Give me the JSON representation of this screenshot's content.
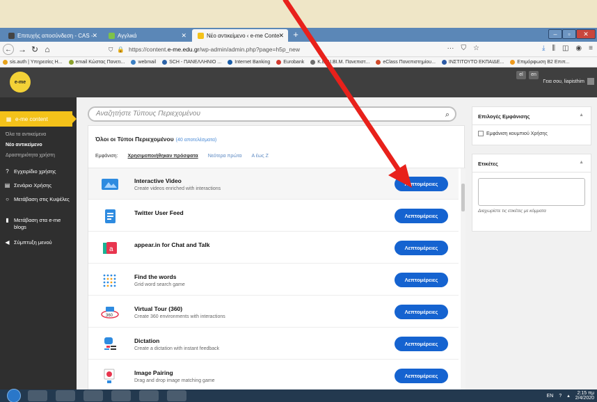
{
  "browser": {
    "tabs": [
      {
        "label": "Επιτυχής αποσύνδεση - CAS -",
        "icon": "cas-tab-icon"
      },
      {
        "label": "Αγγλικά",
        "icon": "translate-tab-icon"
      },
      {
        "label": "Νέο αντικείμενο ‹ e-me Conte",
        "icon": "eme-tab-icon"
      }
    ],
    "url_prefix": "https://content.",
    "url_domain": "e-me.edu.gr",
    "url_suffix": "/wp-admin/admin.php?page=h5p_new",
    "url_more": "···"
  },
  "bookmarks": [
    {
      "label": "sis.auth | Υπηρεσίες Η...",
      "color": "#e7a21b"
    },
    {
      "label": "email Κώστας Πανετι...",
      "color": "#8aa02c"
    },
    {
      "label": "webmail",
      "color": "#3b7fc3"
    },
    {
      "label": "SCH - ΠΑΝΕΛΛΗΝΙΟ ...",
      "color": "#2c63a8"
    },
    {
      "label": "Internet Banking",
      "color": "#1a5da8"
    },
    {
      "label": "Eurobank",
      "color": "#d23a2f"
    },
    {
      "label": "Κ.Ε.ΔΙ.ΒΙ.Μ. Πανεπιστ...",
      "color": "#6d6d6d"
    },
    {
      "label": "eClass Πανεπιστημίου...",
      "color": "#d04a2a"
    },
    {
      "label": "ΙΝΣΤΙΤΟΥΤΟ ΕΚΠΑΙΔΕ...",
      "color": "#2b5aa5"
    },
    {
      "label": "Επιμόρφωση Β2 Επιπ...",
      "color": "#ef9a1c"
    }
  ],
  "wp": {
    "logo_text": "e-me",
    "lang_el": "el",
    "lang_en": "en",
    "greeting": "Γεια σου, liapisthim"
  },
  "sidebar": {
    "section": "e-me content",
    "subitems": [
      "Όλα τα αντικείμενα",
      "Νέο αντικείμενο",
      "Δραστηριότητα χρήστη"
    ],
    "items": [
      {
        "label": "Εγχειρίδιο χρήσης",
        "icon": "help-circle-icon"
      },
      {
        "label": "Σενάριο Χρήσης",
        "icon": "document-icon"
      },
      {
        "label": "Μετάβαση στις Κυψέλες",
        "icon": "circle-outline-icon"
      },
      {
        "label": "Μετάβαση στα e-me blogs",
        "icon": "pen-icon"
      },
      {
        "label": "Σύμπτυξη μενού",
        "icon": "collapse-arrow-icon"
      }
    ]
  },
  "main": {
    "search_placeholder": "Αναζητήστε Τύπους Περιεχομένου",
    "panel_title": "Όλοι οι Τύποι Περιεχομένου",
    "panel_count": "(40 αποτελέσματα)",
    "sort_label": "Εμφάνιση:",
    "sort_current": "Χρησιμοποιήθηκαν πρόσφατα",
    "sort_options": [
      "Νεότερα πρώτα",
      "Α έως Ζ"
    ],
    "button_label": "Λεπτομέρειες",
    "content_types": [
      {
        "title": "Interactive Video",
        "desc": "Create videos enriched with interactions",
        "icon": "interactive-video-icon"
      },
      {
        "title": "Twitter User Feed",
        "desc": "",
        "icon": "twitter-feed-icon"
      },
      {
        "title": "appear.in for Chat and Talk",
        "desc": "",
        "icon": "appear-in-icon"
      },
      {
        "title": "Find the words",
        "desc": "Grid word search game",
        "icon": "find-words-icon"
      },
      {
        "title": "Virtual Tour (360)",
        "desc": "Create 360 environments with interactions",
        "icon": "virtual-tour-icon"
      },
      {
        "title": "Dictation",
        "desc": "Create a dictation with instant feedback",
        "icon": "dictation-icon"
      },
      {
        "title": "Image Pairing",
        "desc": "Drag and drop image matching game",
        "icon": "image-pairing-icon"
      }
    ]
  },
  "right": {
    "display_options_title": "Επιλογές Εμφάνισης",
    "display_checkbox": "Εμφάνιση κουμπιού Χρήσης",
    "tags_title": "Ετικέτες",
    "tags_hint": "Διαχωρίστε τις ετικέτες με κόμματα"
  },
  "taskbar": {
    "lang": "EN",
    "time": "2:15 πμ",
    "date": "2/4/2020"
  },
  "colors": {
    "accent": "#f4c21a",
    "button": "#1563d0",
    "annotation_arrow": "#e8211b"
  }
}
